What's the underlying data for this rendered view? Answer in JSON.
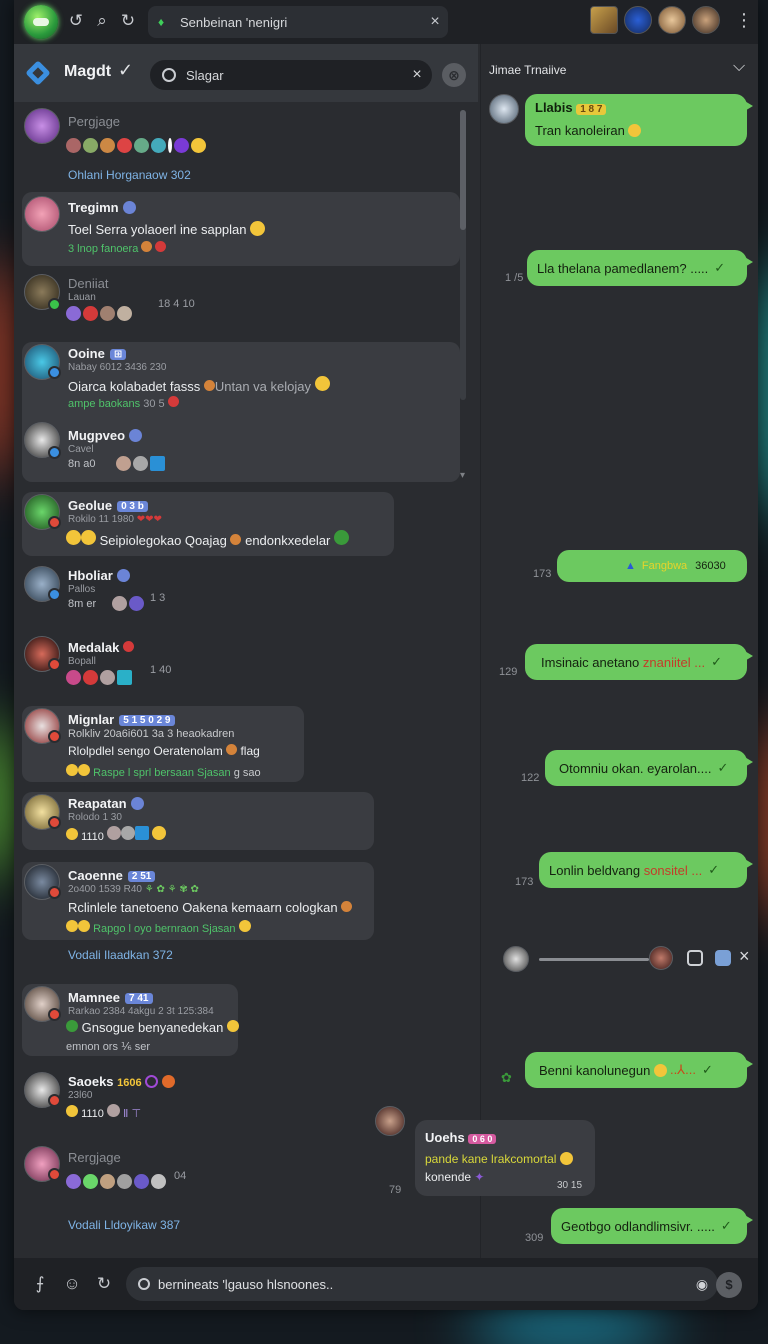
{
  "colors": {
    "accent": "#6cc960",
    "link": "#7fb4e6",
    "tag": "#6a86d8",
    "panel": "#2a2c30"
  },
  "titlebar": {
    "icons": [
      "app-logo",
      "back-icon",
      "search-icon",
      "refresh-icon"
    ],
    "tab_title": "Senbeinan 'nenigri",
    "more": "⋮"
  },
  "sidebar": {
    "title": "Magdt",
    "search_value": "Slagar",
    "scroll_down": "▾"
  },
  "chats": [
    {
      "name": "Pergjage",
      "sub": "",
      "num": ""
    },
    {
      "name": "Tregimn",
      "line": "Toel Serra yolaoerl ine sapplan",
      "green": "3 lnop fanoera"
    },
    {
      "name": "Deniiat",
      "sub": "Lauan",
      "num": "18 4 10"
    },
    {
      "name": "Ooine",
      "tag": "⊞",
      "sub": "Nabay 6012 3436 230",
      "line": "Oiarca kolabadet fasss",
      "line_extra": "Untan va kelojay",
      "green": "ampe baokans",
      "num_inline": "30 5"
    },
    {
      "name": "Mugpveo",
      "sub": "Cavel",
      "num_inline": "8n a0"
    },
    {
      "name": "Geolue",
      "tag": "0 3 b",
      "sub": "Rokilo 11 1980",
      "line": "Seipiolegokao Qoajag",
      "line_extra": "endonkxedelar"
    },
    {
      "name": "Hboliar",
      "sub": "Pallos",
      "num": "1 3",
      "num_inline": "8m er"
    },
    {
      "name": "Medalak",
      "sub": "Bopall",
      "num": "1 40"
    },
    {
      "name": "Mignlar",
      "tag": "5 1 5 0 2 9",
      "sub": "Rolkliv 20a6i601 3a 3 heaokadren",
      "line": "Rlolpdlel sengo Oeratenolam",
      "line_extra": "flag",
      "green": "Raspe l sprl bersaan Sjasan",
      "green_extra": "g sao"
    },
    {
      "name": "Reapatan",
      "sub": "Rolodo 1 30",
      "num_inline": "1110"
    },
    {
      "name": "Caoenne",
      "tag": "2 51",
      "sub": "2o400 1539 R40",
      "line": "Rclinlele tanetoeno Oakena kemaarn cologkan",
      "green": "Rapgo l oyo bernraon Sjasan"
    },
    {
      "name": "Mamnee",
      "tag": "7 41",
      "sub": "Rarkao 2384 4akgu 2 3t 125:384",
      "line": "Gnsogue benyanedekan",
      "footnote": "emnon ors ⅙ ser"
    },
    {
      "name": "Saoeks",
      "tag_plain": "1606",
      "sub": "23l60",
      "num_inline": "1110"
    },
    {
      "name": "Rergjage",
      "sub": "",
      "num": "04"
    }
  ],
  "section_labels": [
    "Ohlani Horganaow 302",
    "Vodali Ilaadkan 372",
    "Vodali Lldoyikaw 387"
  ],
  "conversation": {
    "title": "Jimae Trnaiive",
    "messages": [
      {
        "sender": "Llabis",
        "tag": "1 8 7",
        "text": "Tran kanoleiran",
        "time": ""
      },
      {
        "text": "Lla thelana pamedlanem? .....",
        "time": "1 /5"
      },
      {
        "text": "Fangbwa",
        "extra": "36030",
        "time": "173"
      },
      {
        "text": "Imsinaic anetano",
        "warn": "znaniitel ...",
        "time": "129"
      },
      {
        "text": "Otomniu okan. eyarolan....",
        "time": "122"
      },
      {
        "text": "Lonlin beldvang",
        "warn": "sonsitel ...",
        "time": "173"
      },
      {
        "text": "Benni kanolunegun",
        "extra2": "..⅄...",
        "time": ""
      },
      {
        "sender": "Uoehs",
        "tag": "0 6 0",
        "text": "pande kane lrakcomortal",
        "text2": "konende",
        "time": "79",
        "stamp": "30 15"
      },
      {
        "text": "Geotbgo odlandlimsivr. .....",
        "time": "309"
      }
    ]
  },
  "composer": {
    "value": "bernineats 'lgauso hlsnoones..",
    "icons": [
      "text-format-icon",
      "emoji-icon",
      "refresh-icon",
      "send-icon"
    ]
  }
}
